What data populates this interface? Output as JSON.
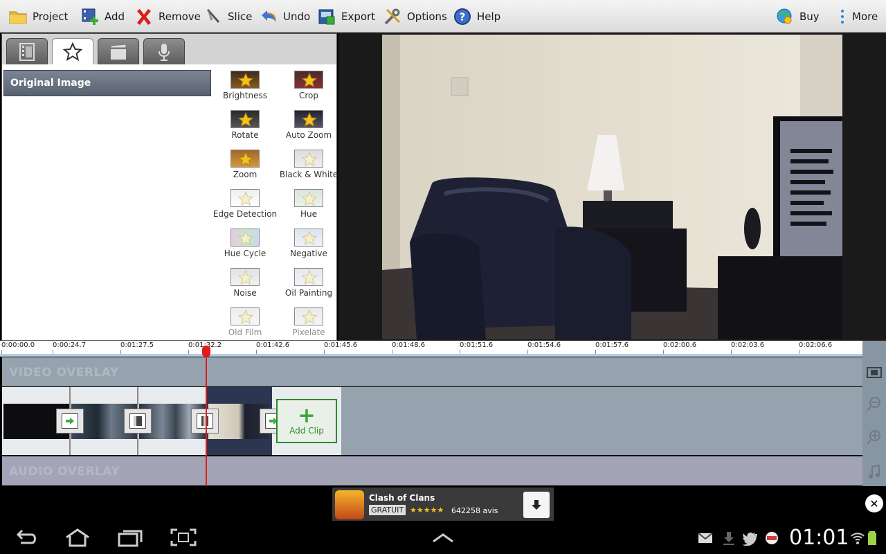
{
  "toolbar": {
    "project": "Project",
    "add": "Add",
    "remove": "Remove",
    "slice": "Slice",
    "undo": "Undo",
    "export": "Export",
    "options": "Options",
    "help": "Help",
    "buy": "Buy",
    "more": "More"
  },
  "effects_panel": {
    "selected": "Original Image",
    "effects": [
      {
        "label": "Brightness"
      },
      {
        "label": "Crop"
      },
      {
        "label": "Rotate"
      },
      {
        "label": "Auto Zoom"
      },
      {
        "label": "Zoom"
      },
      {
        "label": "Black & White"
      },
      {
        "label": "Edge Detection"
      },
      {
        "label": "Hue"
      },
      {
        "label": "Hue Cycle"
      },
      {
        "label": "Negative"
      },
      {
        "label": "Noise"
      },
      {
        "label": "Oil Painting"
      },
      {
        "label": "Old Film"
      },
      {
        "label": "Pixelate"
      }
    ]
  },
  "timeline": {
    "ticks": [
      "0:00:00.0",
      "0:00:24.7",
      "0:01:27.5",
      "0:01:32.2",
      "0:01:42.6",
      "0:01:45.6",
      "0:01:48.6",
      "0:01:51.6",
      "0:01:54.6",
      "0:01:57.6",
      "0:02:00.6",
      "0:02:03.6",
      "0:02:06.6"
    ],
    "video_overlay": "VIDEO OVERLAY",
    "audio_overlay": "AUDIO OVERLAY",
    "add_clip": "Add Clip"
  },
  "ad": {
    "title": "Clash of Clans",
    "price": "GRATUIT",
    "rating": "★★★★★",
    "reviews": "642258 avis"
  },
  "status": {
    "clock": "01:01"
  }
}
